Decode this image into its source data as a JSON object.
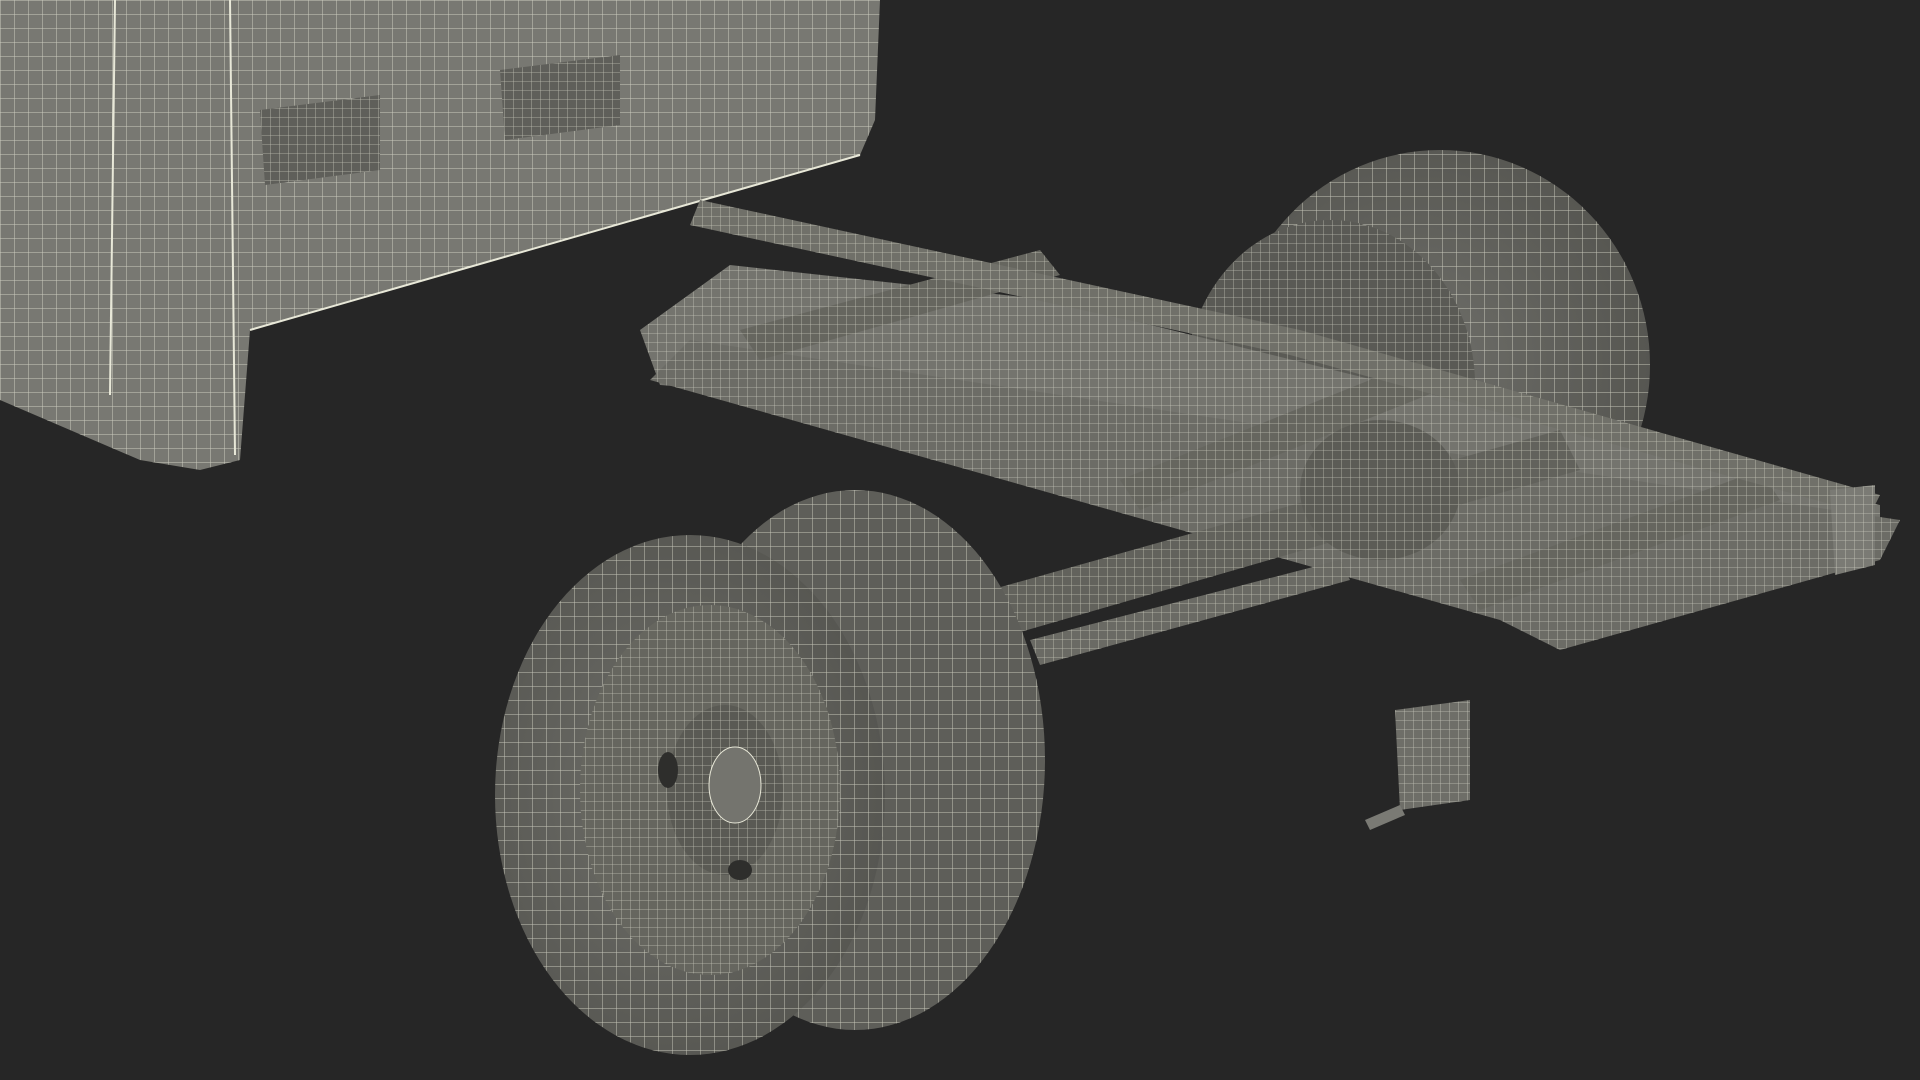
{
  "scene": {
    "subject": "truck-chassis-wireframe",
    "colors": {
      "background": "#262626",
      "surface": "#7a7a74",
      "surface_dark": "#5c5c57",
      "surface_shadow": "#3e3e3b",
      "wire": "#e8e8d8"
    }
  }
}
